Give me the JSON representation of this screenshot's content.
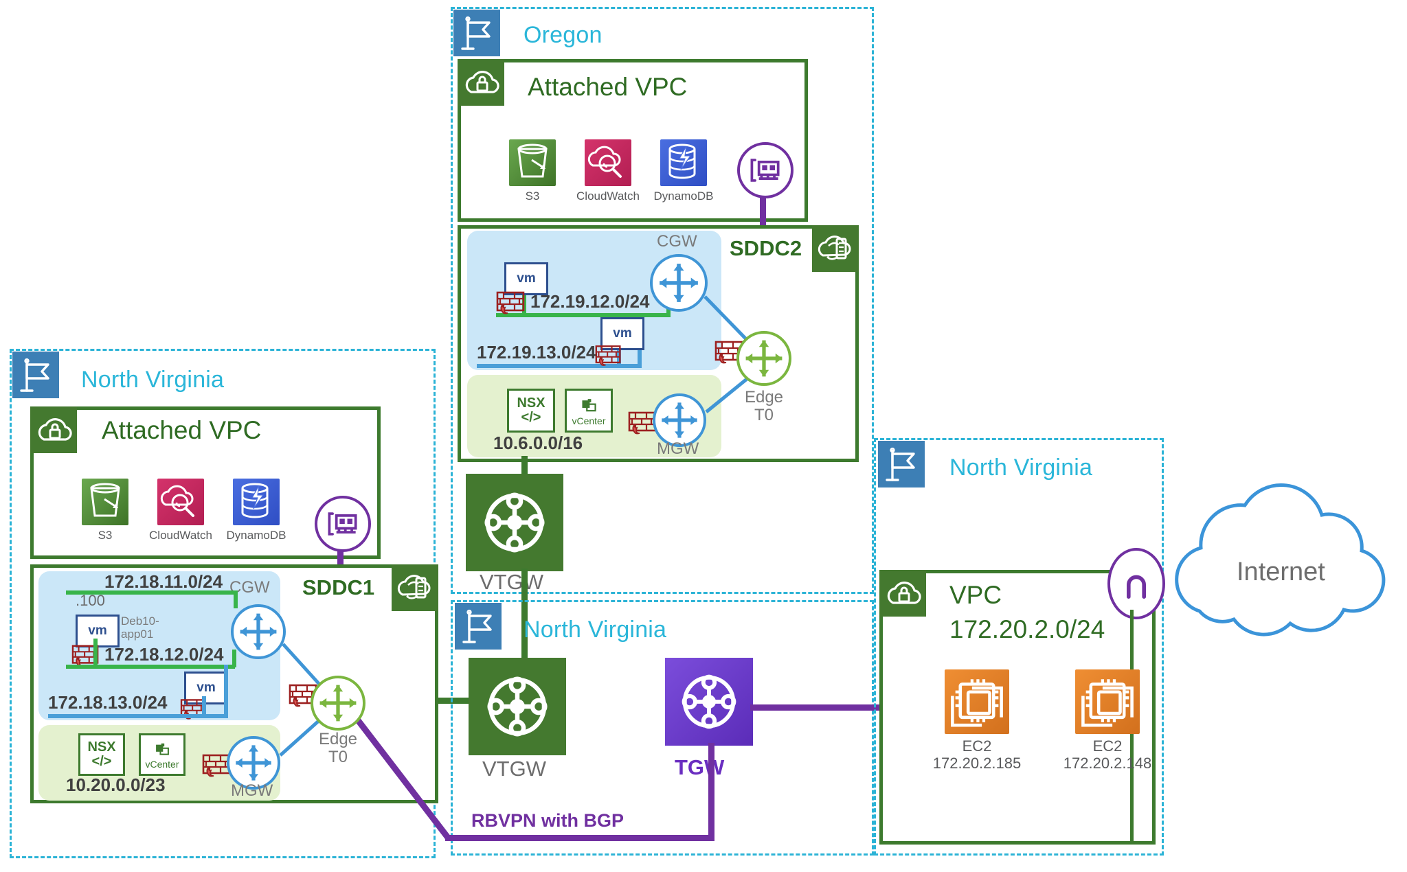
{
  "regions": [
    {
      "name": "oregon",
      "label": "Oregon"
    },
    {
      "name": "north-virginia-left",
      "label": "North Virginia"
    },
    {
      "name": "north-virginia-middle",
      "label": "North Virginia"
    },
    {
      "name": "north-virginia-right",
      "label": "North Virginia"
    }
  ],
  "oregon": {
    "region_label": "Oregon",
    "attached_vpc": {
      "title": "Attached VPC",
      "services": [
        {
          "name": "s3",
          "label": "S3"
        },
        {
          "name": "cloudwatch",
          "label": "CloudWatch"
        },
        {
          "name": "dynamodb",
          "label": "DynamoDB"
        }
      ],
      "eni_icon": "network-interface-icon"
    },
    "sddc": {
      "title": "SDDC2",
      "cgw_label": "CGW",
      "mgw_label": "MGW",
      "edge_label": "Edge\nT0",
      "edge_label_line1": "Edge",
      "edge_label_line2": "T0",
      "compute_networks": [
        {
          "cidr": "172.19.12.0/24"
        },
        {
          "cidr": "172.19.13.0/24"
        }
      ],
      "vm_label": "vm",
      "mgmt_cidr": "10.6.0.0/16",
      "nsx_label_line1": "NSX",
      "nsx_label_line2": "</>",
      "vcenter_label": "vCenter"
    },
    "vtgw": {
      "label": "VTGW"
    }
  },
  "north_virginia_left": {
    "region_label": "North Virginia",
    "attached_vpc": {
      "title": "Attached VPC",
      "services": [
        {
          "name": "s3",
          "label": "S3"
        },
        {
          "name": "cloudwatch",
          "label": "CloudWatch"
        },
        {
          "name": "dynamodb",
          "label": "DynamoDB"
        }
      ],
      "eni_icon": "network-interface-icon"
    },
    "sddc": {
      "title": "SDDC1",
      "cgw_label": "CGW",
      "mgw_label": "MGW",
      "edge_label_line1": "Edge",
      "edge_label_line2": "T0",
      "compute_networks": [
        {
          "cidr": "172.18.11.0/24"
        },
        {
          "cidr": "172.18.12.0/24"
        },
        {
          "cidr": "172.18.13.0/24"
        }
      ],
      "vm_host_ip": ".100",
      "vm_host_name_line1": "Deb10-",
      "vm_host_name_line2": "app01",
      "vm_label": "vm",
      "mgmt_cidr": "10.20.0.0/23",
      "nsx_label_line1": "NSX",
      "nsx_label_line2": "</>",
      "vcenter_label": "vCenter"
    }
  },
  "north_virginia_middle": {
    "region_label": "North Virginia",
    "vtgw": {
      "label": "VTGW"
    },
    "tgw": {
      "label": "TGW"
    },
    "rbvpn_label": "RBVPN with BGP"
  },
  "north_virginia_right": {
    "region_label": "North Virginia",
    "vpc": {
      "title": "VPC",
      "cidr": "172.20.2.0/24",
      "igw_icon": "internet-gateway-icon",
      "instances": [
        {
          "name": "ec2-1",
          "label": "EC2",
          "ip": "172.20.2.185"
        },
        {
          "name": "ec2-2",
          "label": "EC2",
          "ip": "172.20.2.148"
        }
      ]
    }
  },
  "internet": {
    "label": "Internet"
  },
  "colors": {
    "region_dash": "#2bb3d6",
    "region_label": "#2ab6d9",
    "flag_bg": "#3d7fb5",
    "vpc_green": "#3d7a2e",
    "tab_green": "#44792f",
    "purple": "#7030a0",
    "tgw_purple": "#5b2cb8",
    "compute_segment": "#cbe7f8",
    "mgmt_segment": "#e4f1cf",
    "gw_blue": "#3f95d6",
    "edge_green": "#7bb63f",
    "segment_green": "#38b44a",
    "firewall_red": "#9c2020",
    "ec2_orange": "#ef8e33",
    "internet_blue": "#3b94d9",
    "text_grey": "#6d6d6d"
  }
}
